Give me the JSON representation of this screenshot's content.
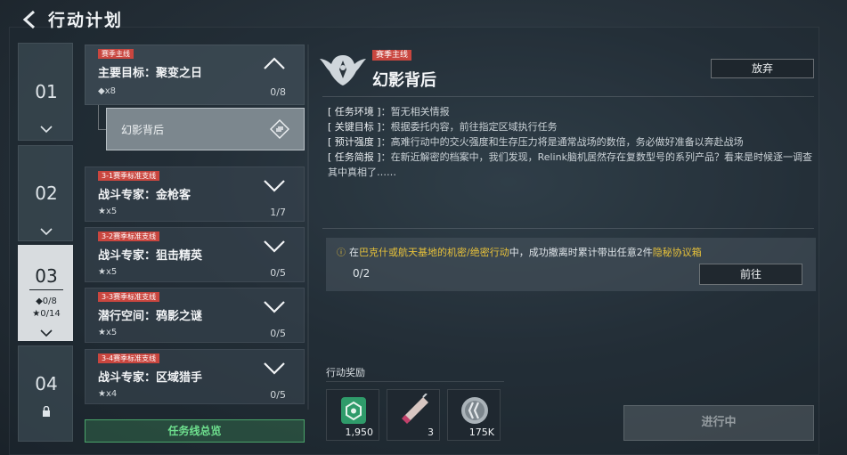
{
  "header": {
    "title": "行动计划"
  },
  "chapters": [
    {
      "num": "01"
    },
    {
      "num": "02"
    },
    {
      "num": "03",
      "diamond": "◆0/8",
      "star": "★0/14"
    },
    {
      "num": "04"
    }
  ],
  "missions": {
    "main": {
      "tag": "赛季主线",
      "title": "主要目标：聚变之日",
      "reward": "◆x8",
      "progress": "0/8"
    },
    "sub": {
      "label": "幻影背后"
    },
    "list": [
      {
        "tag": "3-1赛季标准支线",
        "title": "战斗专家：金枪客",
        "reward": "★x5",
        "progress": "1/7"
      },
      {
        "tag": "3-2赛季标准支线",
        "title": "战斗专家：狙击精英",
        "reward": "★x5",
        "progress": "0/5"
      },
      {
        "tag": "3-3赛季标准支线",
        "title": "潜行空间：鸦影之谜",
        "reward": "★x5",
        "progress": "0/5"
      },
      {
        "tag": "3-4赛季标准支线",
        "title": "战斗专家：区域猎手",
        "reward": "★x4",
        "progress": "0/5"
      }
    ],
    "overview_label": "任务线总览"
  },
  "detail": {
    "tag": "赛季主线",
    "title": "幻影背后",
    "abandon_label": "放弃",
    "info": [
      {
        "key": "[ 任务环境 ]",
        "value": "：暂无相关情报"
      },
      {
        "key": "[ 关键目标 ]",
        "value": "：根据委托内容，前往指定区域执行任务"
      },
      {
        "key": "[ 预计强度 ]",
        "value": "：高难行动中的交火强度和生存压力将是通常战场的数倍，务必做好准备以奔赴战场"
      },
      {
        "key": "[ 任务简报 ]",
        "value": "：在新近解密的档案中，我们发现，Relink脑机居然存在复数型号的系列产品？看来是时候逐一调查其中真相了……"
      }
    ],
    "objective": {
      "prefix": "在",
      "place": "巴克什或航天基地的机密/绝密行动",
      "middle": "中，成功撤离时累计带出任意2件",
      "item": "隐秘协议箱",
      "progress": "0/2",
      "go_label": "前往"
    },
    "rewards_title": "行动奖励",
    "rewards": [
      {
        "icon": "green-badge-icon",
        "count": "1,950"
      },
      {
        "icon": "syringe-icon",
        "count": "3"
      },
      {
        "icon": "coin-icon",
        "count": "175K"
      }
    ],
    "status_label": "进行中"
  },
  "colors": {
    "tag_red": "#c9463f",
    "accent_yellow": "#e8c23a",
    "accent_green": "#4aa56a"
  }
}
